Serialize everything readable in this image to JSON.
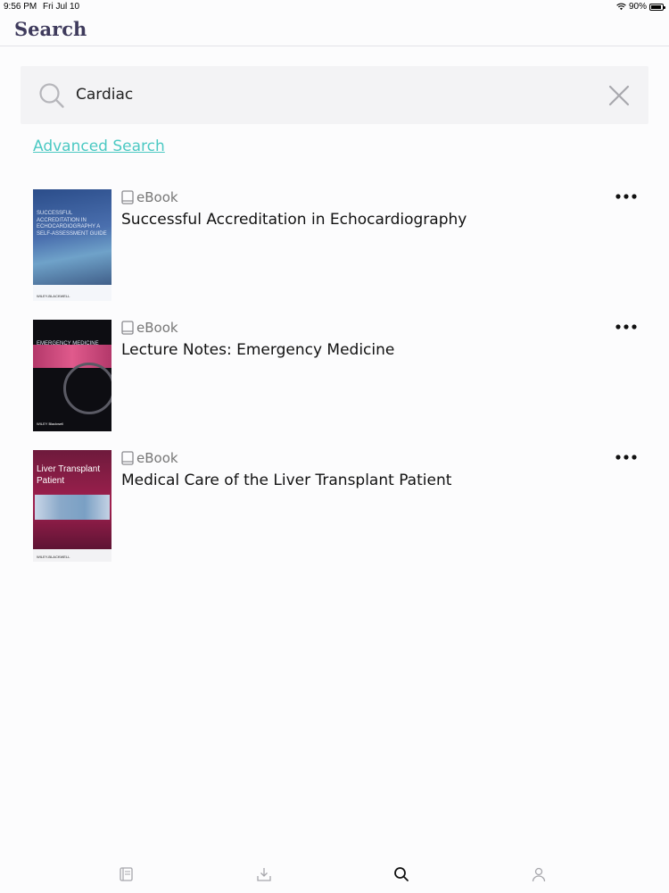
{
  "status_bar": {
    "time": "9:56 PM",
    "date": "Fri Jul 10",
    "battery": "90%",
    "icons": [
      "wifi-icon",
      "battery-icon"
    ]
  },
  "header": {
    "title": "Search"
  },
  "search": {
    "value": "Cardiac",
    "icons": [
      "search-icon",
      "clear-icon"
    ]
  },
  "advanced_search_label": "Advanced Search",
  "results": [
    {
      "type": "eBook",
      "title": "Successful Accreditation in Echocardiography",
      "cover_text": "SUCCESSFUL ACCREDITATION IN ECHOCARDIOGRAPHY A SELF-ASSESSMENT GUIDE",
      "cover_publisher": "WILEY-BLACKWELL"
    },
    {
      "type": "eBook",
      "title": "Lecture Notes: Emergency Medicine",
      "cover_text": "EMERGENCY MEDICINE",
      "cover_publisher": "WILEY Blackwell"
    },
    {
      "type": "eBook",
      "title": "Medical Care of the Liver Transplant Patient",
      "cover_text": "Liver Transplant Patient",
      "cover_publisher": "WILEY-BLACKWELL"
    }
  ],
  "tab_bar": {
    "tabs": [
      "library-icon",
      "downloads-icon",
      "search-icon",
      "account-icon"
    ],
    "active": "search-icon"
  },
  "colors": {
    "accent": "#4cc9c3",
    "title": "#3e3a5c",
    "search_background": "#f3f3f5"
  }
}
